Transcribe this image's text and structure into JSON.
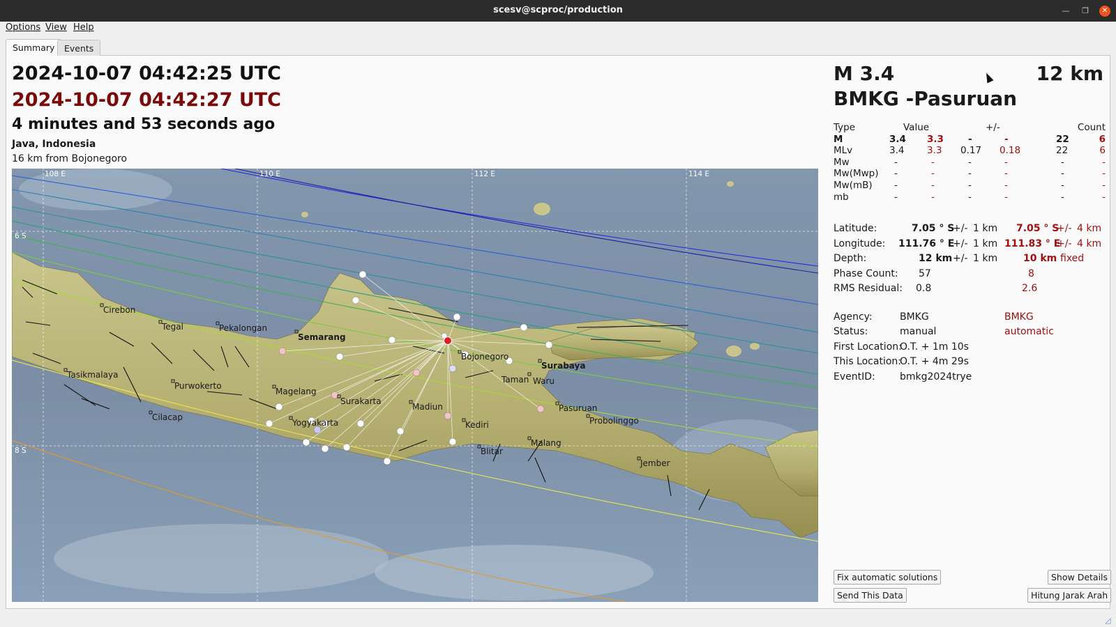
{
  "window": {
    "title": "scesv@scproc/production"
  },
  "menu": [
    "Options",
    "View",
    "Help"
  ],
  "tabs": [
    "Summary",
    "Events"
  ],
  "summary": {
    "time1": "2024-10-07 04:42:25 UTC",
    "time2": "2024-10-07 04:42:27 UTC",
    "ago": "4 minutes and 53 seconds ago",
    "region": "Java, Indonesia",
    "distance": "16 km from Bojonegoro"
  },
  "map": {
    "lon_labels": [
      "108 E",
      "110 E",
      "112 E",
      "114 E"
    ],
    "lat_labels": [
      "6 S",
      "8 S"
    ],
    "cities": [
      "Cirebon",
      "Tegal",
      "Pekalongan",
      "Semarang",
      "Tasikmalaya",
      "Purwokerto",
      "Cilacap",
      "Magelang",
      "Surakarta",
      "Yogyakarta",
      "Madiun",
      "Bojonegoro",
      "Kediri",
      "Blitar",
      "Malang",
      "Surabaya",
      "Taman",
      "Waru",
      "Pasuruan",
      "Probolinggo",
      "Jember"
    ]
  },
  "event": {
    "magnitude": "M 3.4",
    "depth_big": "12 km",
    "name": "BMKG -Pasuruan"
  },
  "mag_table": {
    "headers": [
      "Type",
      "Value",
      "+/-",
      "Count"
    ],
    "rows": [
      [
        "M",
        "3.4",
        "3.3",
        "-",
        "-",
        "22",
        "6"
      ],
      [
        "MLv",
        "3.4",
        "3.3",
        "0.17",
        "0.18",
        "22",
        "6"
      ],
      [
        "Mw",
        "-",
        "-",
        "-",
        "-",
        "-",
        "-"
      ],
      [
        "Mw(Mwp)",
        "-",
        "-",
        "-",
        "-",
        "-",
        "-"
      ],
      [
        "Mw(mB)",
        "-",
        "-",
        "-",
        "-",
        "-",
        "-"
      ],
      [
        "mb",
        "-",
        "-",
        "-",
        "-",
        "-",
        "-"
      ]
    ]
  },
  "origin": {
    "latitude": {
      "label": "Latitude:",
      "v1": "7.05 ° S",
      "pm": "+/-",
      "e1": "1 km",
      "v2": "7.05 ° S",
      "e2": "4 km"
    },
    "longitude": {
      "label": "Longitude:",
      "v1": "111.76 ° E",
      "pm": "+/-",
      "e1": "1 km",
      "v2": "111.83 ° E",
      "e2": "4 km"
    },
    "depth": {
      "label": "Depth:",
      "v1": "12 km",
      "pm": "+/-",
      "e1": "1 km",
      "v2": "10 km",
      "e2": "fixed"
    },
    "phase_count": {
      "label": "Phase Count:",
      "v1": "57",
      "v2": "8"
    },
    "rms": {
      "label": "RMS Residual:",
      "v1": "0.8",
      "v2": "2.6"
    },
    "agency": {
      "label": "Agency:",
      "v1": "BMKG",
      "v2": "BMKG"
    },
    "status": {
      "label": "Status:",
      "v1": "manual",
      "v2": "automatic"
    },
    "first_location": {
      "label": "First Location:",
      "v1": "O.T. + 1m 10s"
    },
    "this_location": {
      "label": "This Location:",
      "v1": "O.T. + 4m 29s"
    },
    "event_id": {
      "label": "EventID:",
      "v1": "bmkg2024trye"
    }
  },
  "buttons": {
    "fix": "Fix automatic solutions",
    "details": "Show Details",
    "send": "Send This Data",
    "hitung": "Hitung Jarak Arah"
  },
  "colors": {
    "title_bar": "#2c2c2c",
    "close": "#e95420",
    "automatic": "#a01010",
    "epicenter": "#e02020"
  }
}
